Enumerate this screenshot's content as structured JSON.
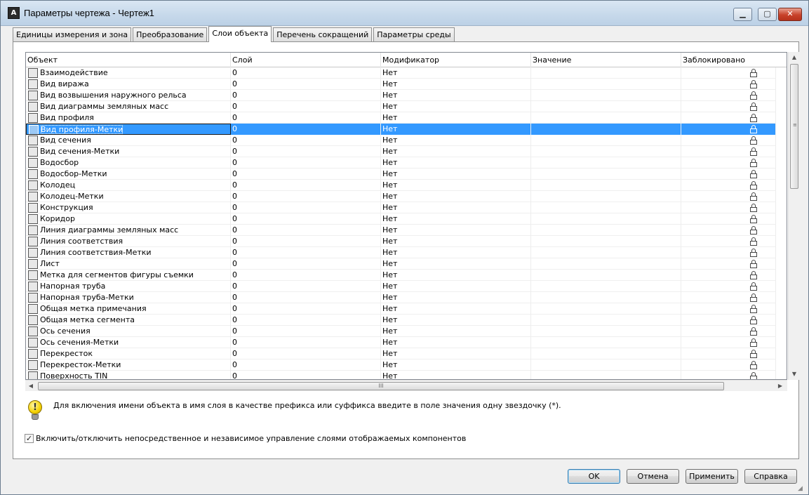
{
  "window": {
    "title": "Параметры чертежа - Чертеж1",
    "app_icon_text": "A"
  },
  "tabs": [
    {
      "label": "Единицы измерения и зона",
      "active": false
    },
    {
      "label": "Преобразование",
      "active": false
    },
    {
      "label": "Слои объекта",
      "active": true
    },
    {
      "label": "Перечень сокращений",
      "active": false
    },
    {
      "label": "Параметры среды",
      "active": false
    }
  ],
  "table": {
    "headers": [
      "Объект",
      "Слой",
      "Модификатор",
      "Значение",
      "Заблокировано"
    ],
    "rows": [
      {
        "object": "Взаимодействие",
        "layer": "0",
        "modifier": "Нет",
        "value": "",
        "icon": "interaction-icon"
      },
      {
        "object": "Вид виража",
        "layer": "0",
        "modifier": "Нет",
        "value": "",
        "icon": "superelevation-view-icon"
      },
      {
        "object": "Вид возвышения наружного рельса",
        "layer": "0",
        "modifier": "Нет",
        "value": "",
        "icon": "cant-view-icon"
      },
      {
        "object": "Вид диаграммы земляных масс",
        "layer": "0",
        "modifier": "Нет",
        "value": "",
        "icon": "mass-haul-view-icon"
      },
      {
        "object": "Вид профиля",
        "layer": "0",
        "modifier": "Нет",
        "value": "",
        "icon": "profile-view-icon"
      },
      {
        "object": "Вид профиля-Метки",
        "layer": "0",
        "modifier": "Нет",
        "value": "",
        "icon": "label-tag-icon",
        "selected": true
      },
      {
        "object": "Вид сечения",
        "layer": "0",
        "modifier": "Нет",
        "value": "",
        "icon": "section-view-icon"
      },
      {
        "object": "Вид сечения-Метки",
        "layer": "0",
        "modifier": "Нет",
        "value": "",
        "icon": "label-tag-icon"
      },
      {
        "object": "Водосбор",
        "layer": "0",
        "modifier": "Нет",
        "value": "",
        "icon": "catchment-icon"
      },
      {
        "object": "Водосбор-Метки",
        "layer": "0",
        "modifier": "Нет",
        "value": "",
        "icon": "label-tag-icon"
      },
      {
        "object": "Колодец",
        "layer": "0",
        "modifier": "Нет",
        "value": "",
        "icon": "structure-icon"
      },
      {
        "object": "Колодец-Метки",
        "layer": "0",
        "modifier": "Нет",
        "value": "",
        "icon": "label-tag-icon"
      },
      {
        "object": "Конструкция",
        "layer": "0",
        "modifier": "Нет",
        "value": "",
        "icon": "assembly-icon"
      },
      {
        "object": "Коридор",
        "layer": "0",
        "modifier": "Нет",
        "value": "",
        "icon": "corridor-icon"
      },
      {
        "object": "Линия диаграммы земляных масс",
        "layer": "0",
        "modifier": "Нет",
        "value": "",
        "icon": "mass-haul-line-icon"
      },
      {
        "object": "Линия соответствия",
        "layer": "0",
        "modifier": "Нет",
        "value": "",
        "icon": "match-line-icon"
      },
      {
        "object": "Линия соответствия-Метки",
        "layer": "0",
        "modifier": "Нет",
        "value": "",
        "icon": "label-tag-icon"
      },
      {
        "object": "Лист",
        "layer": "0",
        "modifier": "Нет",
        "value": "",
        "icon": "sheet-icon"
      },
      {
        "object": "Метка для сегментов фигуры съемки",
        "layer": "0",
        "modifier": "Нет",
        "value": "",
        "icon": "label-tag-icon"
      },
      {
        "object": "Напорная труба",
        "layer": "0",
        "modifier": "Нет",
        "value": "",
        "icon": "pressure-pipe-icon"
      },
      {
        "object": "Напорная труба-Метки",
        "layer": "0",
        "modifier": "Нет",
        "value": "",
        "icon": "label-tag-icon"
      },
      {
        "object": "Общая метка примечания",
        "layer": "0",
        "modifier": "Нет",
        "value": "",
        "icon": "label-tag-icon"
      },
      {
        "object": "Общая метка сегмента",
        "layer": "0",
        "modifier": "Нет",
        "value": "",
        "icon": "label-tag-icon"
      },
      {
        "object": "Ось сечения",
        "layer": "0",
        "modifier": "Нет",
        "value": "",
        "icon": "sample-line-icon"
      },
      {
        "object": "Ось сечения-Метки",
        "layer": "0",
        "modifier": "Нет",
        "value": "",
        "icon": "label-tag-icon"
      },
      {
        "object": "Перекресток",
        "layer": "0",
        "modifier": "Нет",
        "value": "",
        "icon": "intersection-icon"
      },
      {
        "object": "Перекресток-Метки",
        "layer": "0",
        "modifier": "Нет",
        "value": "",
        "icon": "label-tag-icon"
      },
      {
        "object": "Поверхность TIN",
        "layer": "0",
        "modifier": "Нет",
        "value": "",
        "icon": "tin-surface-icon"
      }
    ]
  },
  "scroll": {
    "h_grip": "III"
  },
  "hint": {
    "text": "Для включения имени объекта в имя слоя в качестве префикса или суффикса введите в поле значения одну звездочку (*).",
    "icon_glyph": "!"
  },
  "checkbox": {
    "label": "Включить/отключить непосредственное и независимое управление слоями отображаемых компонентов",
    "checked": true
  },
  "buttons": {
    "ok": "OK",
    "cancel": "Отмена",
    "apply": "Применить",
    "help": "Справка"
  }
}
